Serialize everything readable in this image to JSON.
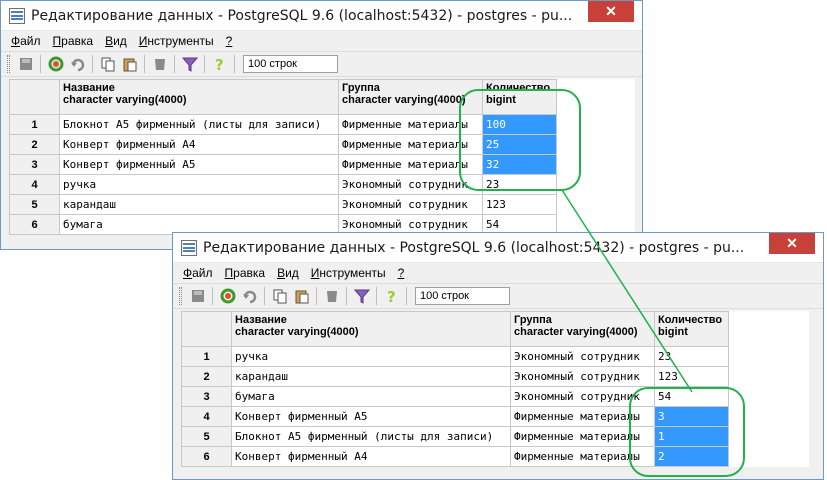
{
  "windows": [
    {
      "title": "Редактирование данных - PostgreSQL 9.6 (localhost:5432) - postgres - pu...",
      "close_label": "✕",
      "menu": [
        {
          "ul": "Ф",
          "rest": "айл"
        },
        {
          "ul": "П",
          "rest": "равка"
        },
        {
          "ul": "В",
          "rest": "ид"
        },
        {
          "ul": "И",
          "rest": "нструменты"
        },
        {
          "ul": "?",
          "rest": ""
        }
      ],
      "limit": "100 строк",
      "columns": [
        {
          "name": "Название",
          "type": "character varying(4000)"
        },
        {
          "name": "Группа",
          "type": "character varying(4000)"
        },
        {
          "name": "Количество",
          "type": "bigint"
        }
      ],
      "rows": [
        {
          "n": "1",
          "name": "Блокнот А5 фирменный (листы для записи)",
          "group": "Фирменные материалы",
          "qty": "100",
          "selected": true
        },
        {
          "n": "2",
          "name": "Конверт фирменный А4",
          "group": "Фирменные материалы",
          "qty": "25",
          "selected": true
        },
        {
          "n": "3",
          "name": "Конверт фирменный А5",
          "group": "Фирменные материалы",
          "qty": "32",
          "selected": true
        },
        {
          "n": "4",
          "name": "ручка",
          "group": "Экономный сотрудник",
          "qty": "23",
          "selected": false
        },
        {
          "n": "5",
          "name": "карандаш",
          "group": "Экономный сотрудник",
          "qty": "123",
          "selected": false
        },
        {
          "n": "6",
          "name": "бумага",
          "group": "Экономный сотрудник",
          "qty": "54",
          "selected": false
        }
      ]
    },
    {
      "title": "Редактирование данных - PostgreSQL 9.6 (localhost:5432) - postgres - pu...",
      "close_label": "✕",
      "menu": [
        {
          "ul": "Ф",
          "rest": "айл"
        },
        {
          "ul": "П",
          "rest": "равка"
        },
        {
          "ul": "В",
          "rest": "ид"
        },
        {
          "ul": "И",
          "rest": "нструменты"
        },
        {
          "ul": "?",
          "rest": ""
        }
      ],
      "limit": "100 строк",
      "columns": [
        {
          "name": "Название",
          "type": "character varying(4000)"
        },
        {
          "name": "Группа",
          "type": "character varying(4000)"
        },
        {
          "name": "Количество",
          "type": "bigint"
        }
      ],
      "rows": [
        {
          "n": "1",
          "name": "ручка",
          "group": "Экономный сотрудник",
          "qty": "23",
          "selected": false
        },
        {
          "n": "2",
          "name": "карандаш",
          "group": "Экономный сотрудник",
          "qty": "123",
          "selected": false
        },
        {
          "n": "3",
          "name": "бумага",
          "group": "Экономный сотрудник",
          "qty": "54",
          "selected": false
        },
        {
          "n": "4",
          "name": "Конверт фирменный А5",
          "group": "Фирменные материалы",
          "qty": "3",
          "selected": true
        },
        {
          "n": "5",
          "name": "Блокнот А5 фирменный (листы для записи)",
          "group": "Фирменные материалы",
          "qty": "1",
          "selected": true
        },
        {
          "n": "6",
          "name": "Конверт фирменный А4",
          "group": "Фирменные материалы",
          "qty": "2",
          "selected": true
        }
      ]
    }
  ],
  "toolbar_icons": [
    "save-icon",
    "refresh-icon",
    "undo-icon",
    "copy-icon",
    "paste-icon",
    "delete-icon",
    "filter-icon",
    "help-icon"
  ],
  "colors": {
    "selection": "#3399ff",
    "annotation": "#22b14c",
    "close": "#c7413a"
  }
}
